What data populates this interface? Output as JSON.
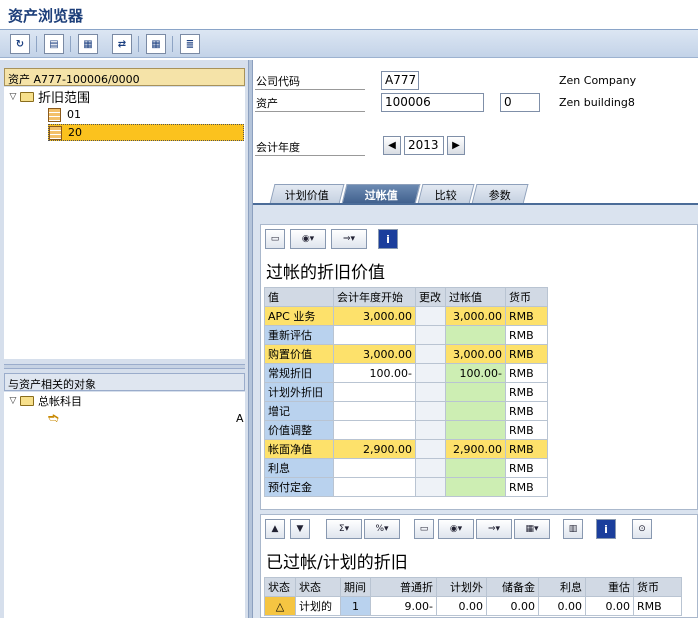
{
  "window": {
    "title": "资产浏览器"
  },
  "toolbar": {
    "icons": [
      "refresh-icon",
      "asset-icon",
      "balance-icon",
      "transfer-icon",
      "grid-icon",
      "list-icon"
    ]
  },
  "left": {
    "header": "资产 A777-100006/0000",
    "tree": {
      "root": "折旧范围",
      "children": [
        "01",
        "20"
      ],
      "selected": "20"
    },
    "objects_header": "与资产相关的对象",
    "objects_tree": {
      "root": "总帐科目",
      "child_fragment": "A"
    }
  },
  "fields": {
    "company_code_label": "公司代码",
    "company_code": "A777",
    "company_name": "Zen Company",
    "asset_label": "资产",
    "asset_number": "100006",
    "sub_number": "0",
    "asset_name": "Zen building8",
    "fiscal_year_label": "会计年度",
    "fiscal_year": "2013"
  },
  "tabs": [
    {
      "label": "计划价值",
      "active": false
    },
    {
      "label": "过帐值",
      "active": true
    },
    {
      "label": "比较",
      "active": false
    },
    {
      "label": "参数",
      "active": false
    }
  ],
  "posted_values": {
    "title": "过帐的折旧价值",
    "columns": [
      "值",
      "会计年度开始",
      "更改",
      "过帐值",
      "货币"
    ],
    "rows": [
      {
        "label": "APC 业务",
        "start": "3,000.00",
        "change": "",
        "posted": "3,000.00",
        "cur": "RMB",
        "hl": "y"
      },
      {
        "label": "重新评估",
        "start": "",
        "change": "",
        "posted": "",
        "cur": "RMB",
        "hl": ""
      },
      {
        "label": "购置价值",
        "start": "3,000.00",
        "change": "",
        "posted": "3,000.00",
        "cur": "RMB",
        "hl": "y"
      },
      {
        "label": "常规折旧",
        "start": "100.00-",
        "change": "",
        "posted": "100.00-",
        "cur": "RMB",
        "hl": ""
      },
      {
        "label": "计划外折旧",
        "start": "",
        "change": "",
        "posted": "",
        "cur": "RMB",
        "hl": ""
      },
      {
        "label": "增记",
        "start": "",
        "change": "",
        "posted": "",
        "cur": "RMB",
        "hl": ""
      },
      {
        "label": "价值调整",
        "start": "",
        "change": "",
        "posted": "",
        "cur": "RMB",
        "hl": ""
      },
      {
        "label": "帐面净值",
        "start": "2,900.00",
        "change": "",
        "posted": "2,900.00",
        "cur": "RMB",
        "hl": "y"
      },
      {
        "label": "利息",
        "start": "",
        "change": "",
        "posted": "",
        "cur": "RMB",
        "hl": ""
      },
      {
        "label": "预付定金",
        "start": "",
        "change": "",
        "posted": "",
        "cur": "RMB",
        "hl": ""
      }
    ]
  },
  "planned": {
    "title": "已过帐/计划的折旧",
    "columns": [
      "状态",
      "状态",
      "期间",
      "普通折",
      "计划外",
      "储备金",
      "利息",
      "重估",
      "货币"
    ],
    "rows": [
      {
        "status_icon": "warning-triangle-icon",
        "status": "计划的",
        "period": "1",
        "ordinary": "9.00-",
        "unplanned": "0.00",
        "reserve": "0.00",
        "interest": "0.00",
        "reval": "0.00",
        "cur": "RMB"
      }
    ]
  },
  "colors": {
    "accent": "#3f5f8c",
    "highlight_yellow": "#fde16b",
    "highlight_green": "#cdeeb3",
    "label_blue": "#b9d2ee"
  }
}
